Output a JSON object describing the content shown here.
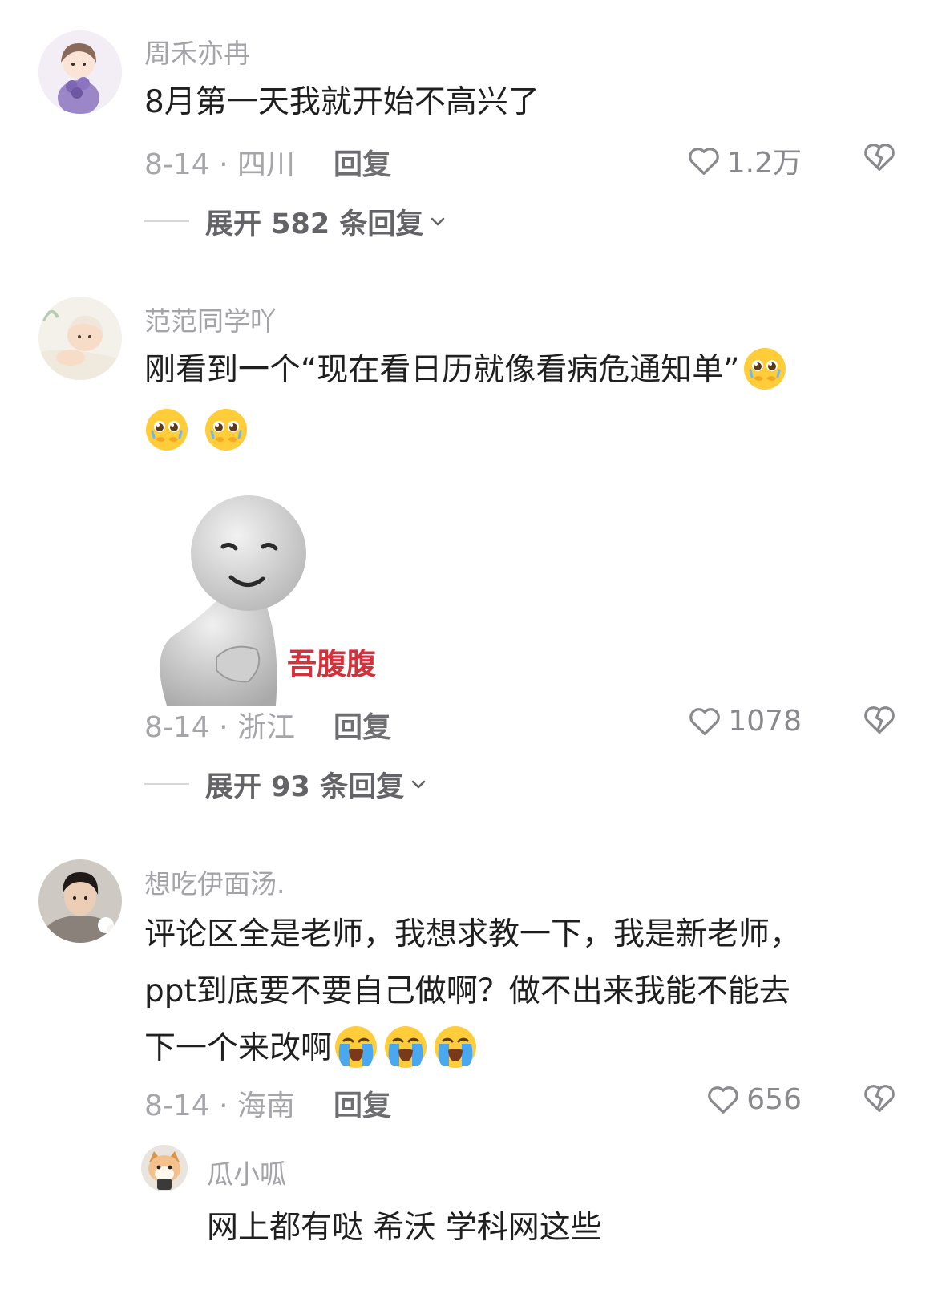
{
  "comments": [
    {
      "username": "周禾亦冉",
      "text_lines": [
        "8月第一天我就开始不高兴了"
      ],
      "date_loc": "8-14 · 四川",
      "reply_label": "回复",
      "like_count": "1.2万",
      "expand_label": "展开 582 条回复"
    },
    {
      "username": "范范同学吖",
      "text_lines": [
        "刚看到一个“现在看日历就像看病危通知单”"
      ],
      "sticker_caption": "吾腹腹",
      "date_loc": "8-14 · 浙江",
      "reply_label": "回复",
      "like_count": "1078",
      "expand_label": "展开 93 条回复"
    },
    {
      "username": "想吃伊面汤.",
      "text_lines": [
        "评论区全是老师，我想求教一下，我是新老师，",
        "ppt到底要不要自己做啊？做不出来我能不能去",
        "下一个来改啊"
      ],
      "date_loc": "8-14 · 海南",
      "reply_label": "回复",
      "like_count": "656"
    }
  ],
  "sub_reply": {
    "username": "瓜小呱",
    "text": "网上都有哒 希沃 学科网这些"
  },
  "icons": {
    "like": "heart-outline-icon",
    "dislike": "broken-heart-icon",
    "expand": "chevron-down-icon",
    "emoji_pleading": "pleading-face-emoji",
    "emoji_crying": "loudly-crying-face-emoji"
  },
  "colors": {
    "username": "#a3a3a8",
    "meta": "#a6a6aa",
    "sticker_caption": "#d6303b"
  }
}
